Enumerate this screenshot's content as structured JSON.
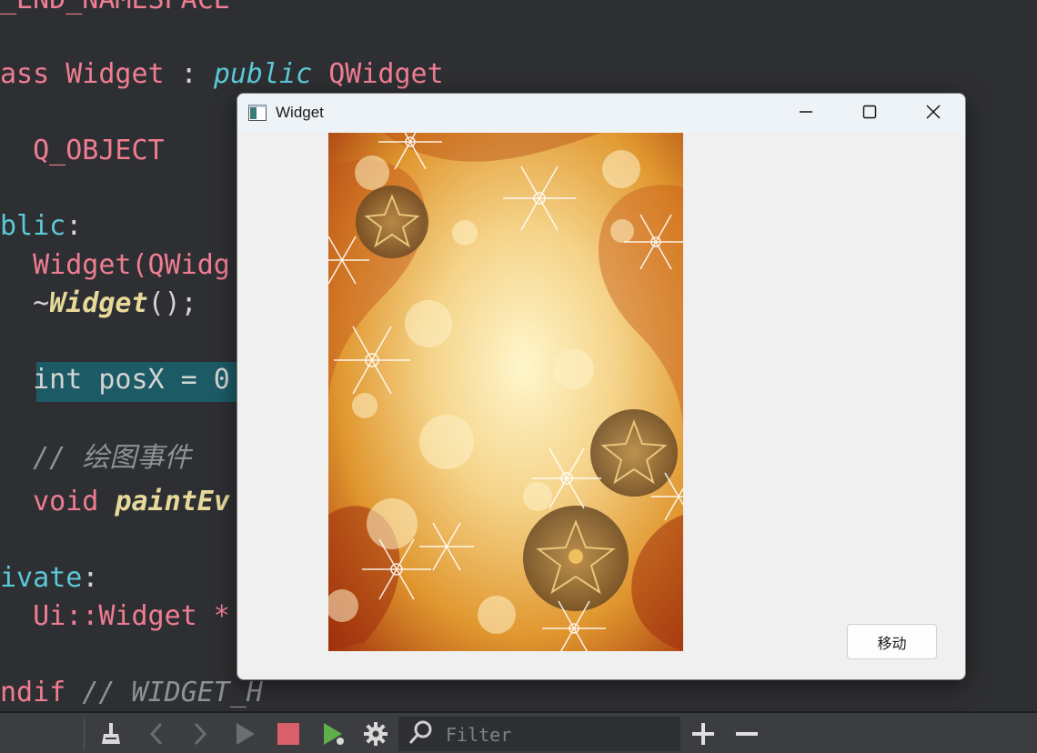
{
  "editor": {
    "lines": [
      {
        "segments": [
          {
            "t": "_END_NAMESPACE",
            "c": "kw-pink"
          }
        ]
      },
      {
        "segments": [
          {
            "t": "ass ",
            "c": "kw-pink"
          },
          {
            "t": "Widget",
            "c": "kw-pink"
          },
          {
            "t": " : ",
            "c": "plain"
          },
          {
            "t": "public",
            "c": "kw-italic"
          },
          {
            "t": " QWidget",
            "c": "kw-pink"
          }
        ]
      },
      {
        "segments": [
          {
            "t": "  Q_OBJECT",
            "c": "kw-pink"
          }
        ]
      },
      {
        "segments": [
          {
            "t": "blic",
            "c": "kw-cyan"
          },
          {
            "t": ":",
            "c": "plain"
          }
        ]
      },
      {
        "segments": [
          {
            "t": "  Widget(QWidg",
            "c": "kw-pink"
          }
        ]
      },
      {
        "segments": [
          {
            "t": "  ~",
            "c": "plain"
          },
          {
            "t": "Widget",
            "c": "fn-bold"
          },
          {
            "t": "();",
            "c": "plain"
          }
        ]
      },
      {
        "segments": [
          {
            "t": "  int posX = 0",
            "c": "plain"
          }
        ]
      },
      {
        "segments": [
          {
            "t": "  // 绘图事件",
            "c": "comment"
          }
        ]
      },
      {
        "segments": [
          {
            "t": "  void ",
            "c": "kw-pink"
          },
          {
            "t": "paintEv",
            "c": "fn-bold"
          }
        ]
      },
      {
        "segments": [
          {
            "t": "ivate",
            "c": "kw-cyan"
          },
          {
            "t": ":",
            "c": "plain"
          }
        ]
      },
      {
        "segments": [
          {
            "t": "  Ui::Widget *",
            "c": "kw-pink"
          }
        ]
      },
      {
        "segments": [
          {
            "t": "ndif ",
            "c": "kw-pink"
          },
          {
            "t": "// WIDGET_H",
            "c": "comment"
          }
        ]
      }
    ]
  },
  "toolbar": {
    "filter_placeholder": "Filter",
    "icons": [
      "clean-icon",
      "back-icon",
      "forward-icon",
      "run-icon",
      "stop-icon",
      "run-debug-icon",
      "settings-icon",
      "search-icon",
      "add-icon",
      "remove-icon"
    ]
  },
  "window": {
    "title": "Widget",
    "move_button_label": "移动",
    "colors": {
      "titlebar": "#eef3f8",
      "client": "#f0f0f0"
    }
  }
}
